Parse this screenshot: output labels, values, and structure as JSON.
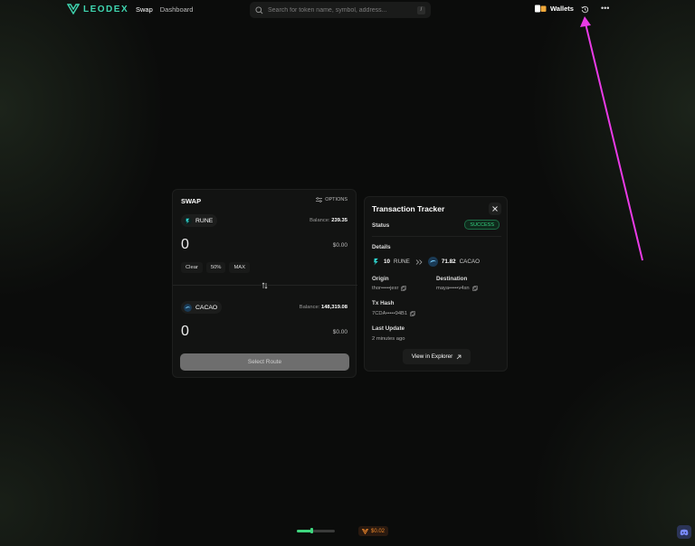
{
  "header": {
    "logo_text": "LEODEX",
    "nav": [
      "Swap",
      "Dashboard"
    ],
    "search_placeholder": "Search for token name, symbol, address...",
    "search_shortcut": "/",
    "wallets_label": "Wallets",
    "more_label": "•••"
  },
  "swap": {
    "title": "SWAP",
    "options_label": "OPTIONS",
    "from": {
      "token": "RUNE",
      "balance_label": "Balance:",
      "balance": "239.35",
      "amount": "0",
      "usd": "$0.00"
    },
    "quick": [
      "Clear",
      "50%",
      "MAX"
    ],
    "to": {
      "token": "CACAO",
      "balance_label": "Balance:",
      "balance": "148,319.08",
      "amount": "0",
      "usd": "$0.00"
    },
    "select_route_label": "Select Route"
  },
  "tracker": {
    "title": "Transaction Tracker",
    "status_label": "Status",
    "status_value": "SUCCESS",
    "details_label": "Details",
    "from_amount": "10",
    "from_token": "RUNE",
    "to_amount": "71.82",
    "to_token": "CACAO",
    "origin_label": "Origin",
    "origin_value": "thor•••••jexr",
    "destination_label": "Destination",
    "destination_value": "maya•••••v4sn",
    "txhash_label": "Tx Hash",
    "txhash_value": "7CDA•••••94B1",
    "last_update_label": "Last Update",
    "last_update_value": "2 minutes ago",
    "explorer_label": "View in Explorer"
  },
  "footer": {
    "progress_fraction": 0.4,
    "price": "$0.02"
  },
  "colors": {
    "accent": "#3fd6b0",
    "success": "#35d07f",
    "annotation_arrow": "#e93be6",
    "price": "#f0882a"
  }
}
